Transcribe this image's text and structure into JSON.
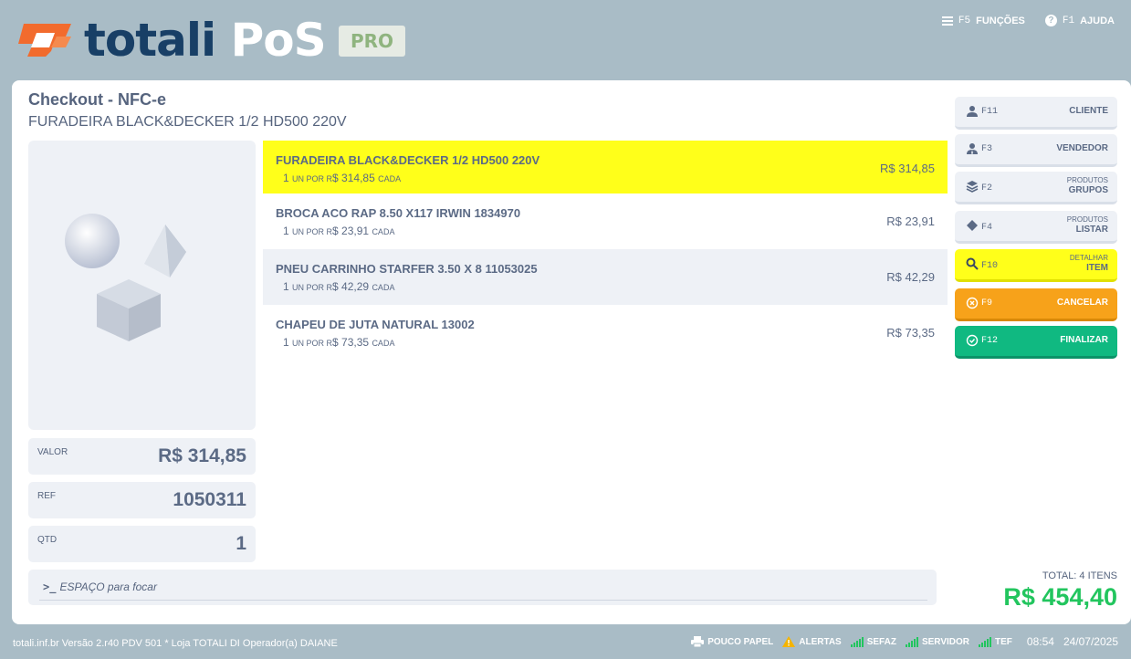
{
  "header": {
    "brand_part1": "totali",
    "brand_part2": "PoS",
    "badge": "PRO",
    "functions_key": "F5",
    "functions_label": "FUNÇÕES",
    "help_key": "F1",
    "help_label": "AJUDA"
  },
  "checkout": {
    "title": "Checkout - NFC-e",
    "subtitle": "FURADEIRA BLACK&DECKER 1/2 HD500 220V"
  },
  "details": {
    "valor_label": "VALOR",
    "valor_value": "R$ 314,85",
    "ref_label": "REF",
    "ref_value": "1050311",
    "qtd_label": "QTD",
    "qtd_value": "1"
  },
  "items": [
    {
      "name": "FURADEIRA BLACK&DECKER 1/2 HD500 220V",
      "qty": "1",
      "unit": "UN POR R",
      "unit_price": "$ 314,85",
      "each": "CADA",
      "price": "R$ 314,85"
    },
    {
      "name": "BROCA ACO RAP 8.50 X117 IRWIN 1834970",
      "qty": "1",
      "unit": "UN POR R",
      "unit_price": "$ 23,91",
      "each": "CADA",
      "price": "R$ 23,91"
    },
    {
      "name": "PNEU CARRINHO STARFER 3.50 X 8 11053025",
      "qty": "1",
      "unit": "UN POR R",
      "unit_price": "$ 42,29",
      "each": "CADA",
      "price": "R$ 42,29"
    },
    {
      "name": "CHAPEU DE JUTA NATURAL 13002",
      "qty": "1",
      "unit": "UN POR R",
      "unit_price": "$ 73,35",
      "each": "CADA",
      "price": "R$ 73,35"
    }
  ],
  "command": {
    "placeholder": "ESPAÇO para focar"
  },
  "actions": {
    "cliente": {
      "key": "F11",
      "label": "CLIENTE"
    },
    "vendedor": {
      "key": "F3",
      "label": "VENDEDOR"
    },
    "grupos": {
      "key": "F2",
      "small": "PRODUTOS",
      "label": "GRUPOS"
    },
    "listar": {
      "key": "F4",
      "small": "PRODUTOS",
      "label": "LISTAR"
    },
    "detalhar": {
      "key": "F10",
      "small": "DETALHAR",
      "label": "ITEM"
    },
    "cancelar": {
      "key": "F9",
      "label": "CANCELAR"
    },
    "finalizar": {
      "key": "F12",
      "label": "FINALIZAR"
    }
  },
  "totals": {
    "label": "TOTAL: 4 ITENS",
    "value": "R$ 454,40"
  },
  "footer": {
    "info": "totali.inf.br Versão 2.r40 PDV 501  *  Loja TOTALI DI Operador(a) DAIANE",
    "paper": "POUCO PAPEL",
    "alerts": "ALERTAS",
    "sefaz": "SEFAZ",
    "servidor": "SERVIDOR",
    "tef": "TEF",
    "time": "08:54",
    "date": "24/07/2025"
  },
  "colors": {
    "background": "#a9bcc6",
    "highlight": "#ffff1a",
    "cancel": "#f7a21a",
    "finish": "#10b981",
    "total": "#22c55e",
    "brand_dark": "#183f66",
    "brand_orange": "#f26b2d"
  }
}
